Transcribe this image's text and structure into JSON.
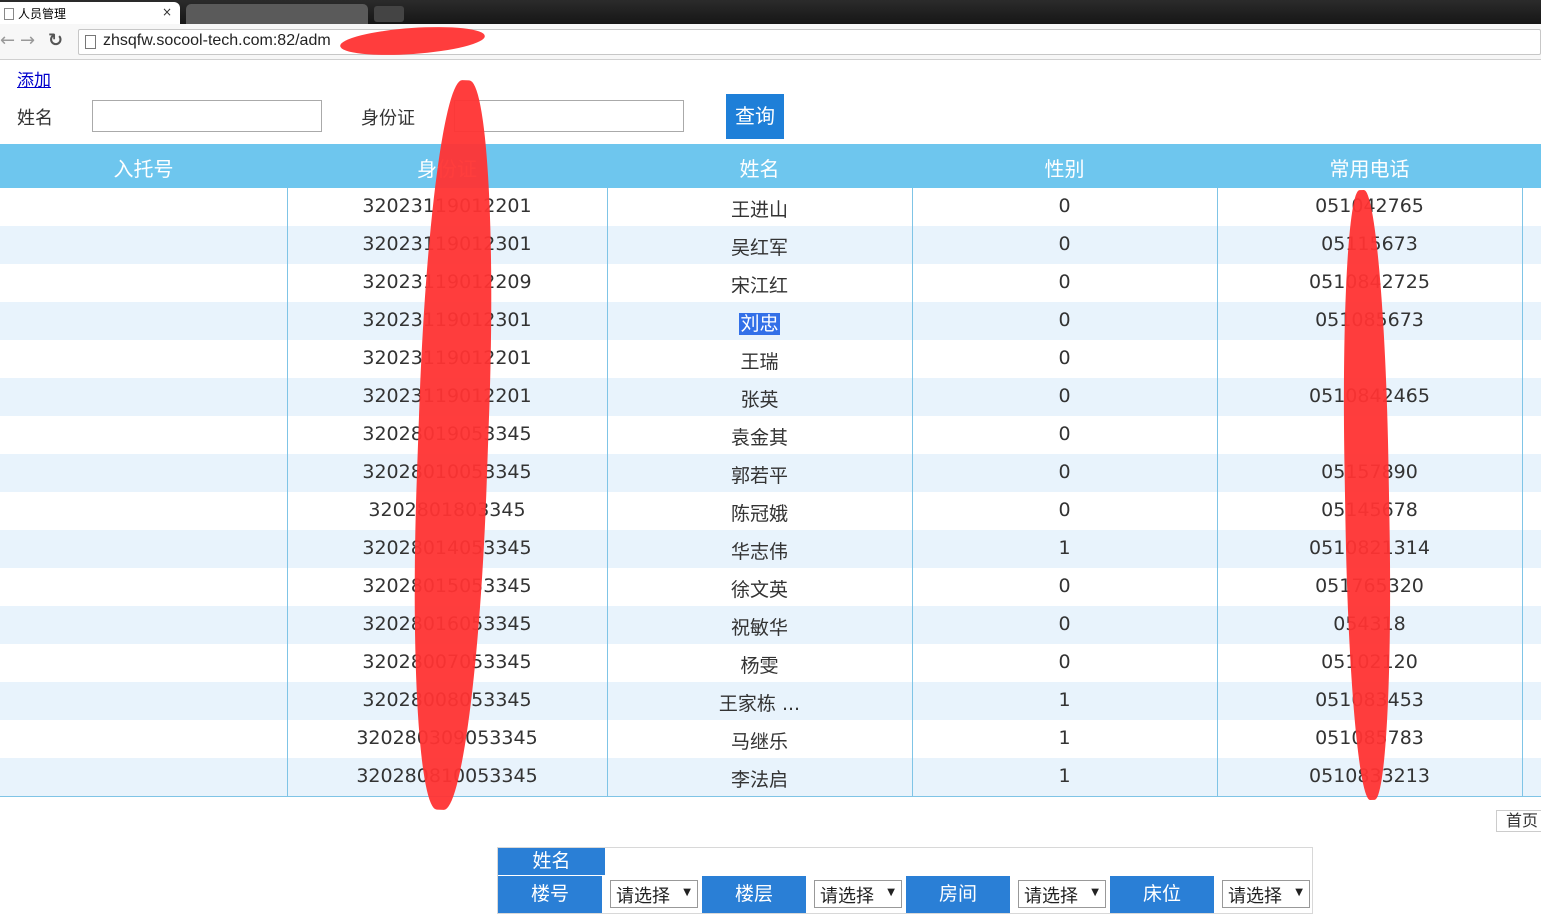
{
  "browser": {
    "active_tab_title": "人员管理",
    "close_glyph": "×",
    "inactive_tab_title": "",
    "url": "zhsqfw.socool-tech.com:82/adm"
  },
  "toolbar_page": {
    "add_link": "添加",
    "name_label": "姓名",
    "id_label": "身份证",
    "name_value": "",
    "id_value": "",
    "query_button": "查询"
  },
  "table": {
    "headers": [
      "入托号",
      "身份证",
      "姓名",
      "性别",
      "常用电话"
    ],
    "rows": [
      {
        "no": "",
        "id": "32023119012201",
        "name": "王进山",
        "gender": "0",
        "phone": "051042765"
      },
      {
        "no": "",
        "id": "32023119012301",
        "name": "吴红军",
        "gender": "0",
        "phone": "05115673"
      },
      {
        "no": "",
        "id": "32023119012209",
        "name": "宋江红",
        "gender": "0",
        "phone": "0510842725"
      },
      {
        "no": "",
        "id": "32023119012301",
        "name": "刘忠",
        "gender": "0",
        "phone": "051085673"
      },
      {
        "no": "",
        "id": "32023119012201",
        "name": "王瑞",
        "gender": "0",
        "phone": ""
      },
      {
        "no": "",
        "id": "32023119012201",
        "name": "张英",
        "gender": "0",
        "phone": "0510842465"
      },
      {
        "no": "",
        "id": "32028019053345",
        "name": "袁金其",
        "gender": "0",
        "phone": ""
      },
      {
        "no": "",
        "id": "32028010053345",
        "name": "郭若平",
        "gender": "0",
        "phone": "05157890"
      },
      {
        "no": "",
        "id": "3202801803345",
        "name": "陈冠娥",
        "gender": "0",
        "phone": "05145678"
      },
      {
        "no": "",
        "id": "32028014053345",
        "name": "华志伟",
        "gender": "1",
        "phone": "0510821314"
      },
      {
        "no": "",
        "id": "32028015053345",
        "name": "徐文英",
        "gender": "0",
        "phone": "051765320"
      },
      {
        "no": "",
        "id": "32028016053345",
        "name": "祝敏华",
        "gender": "0",
        "phone": "054318"
      },
      {
        "no": "",
        "id": "32028007053345",
        "name": "杨雯",
        "gender": "0",
        "phone": "05102120"
      },
      {
        "no": "",
        "id": "32028008053345",
        "name": "王家栋 ...",
        "gender": "1",
        "phone": "051083453"
      },
      {
        "no": "",
        "id": "320280309053345",
        "name": "马继乐",
        "gender": "1",
        "phone": "051085783"
      },
      {
        "no": "",
        "id": "320280810053345",
        "name": "李法启",
        "gender": "1",
        "phone": "0510833213"
      }
    ],
    "selected_row": 3
  },
  "pager": {
    "first_page": "首页"
  },
  "form": {
    "name_label": "姓名",
    "building_label": "楼号",
    "floor_label": "楼层",
    "room_label": "房间",
    "bed_label": "床位",
    "select_placeholder": "请选择",
    "arrow_glyph": "▼"
  },
  "colors": {
    "header_bg": "#6ec6ee",
    "row_alt_bg": "#e8f3fc",
    "button_bg": "#1e7fd8",
    "redaction": "#ff3333"
  }
}
